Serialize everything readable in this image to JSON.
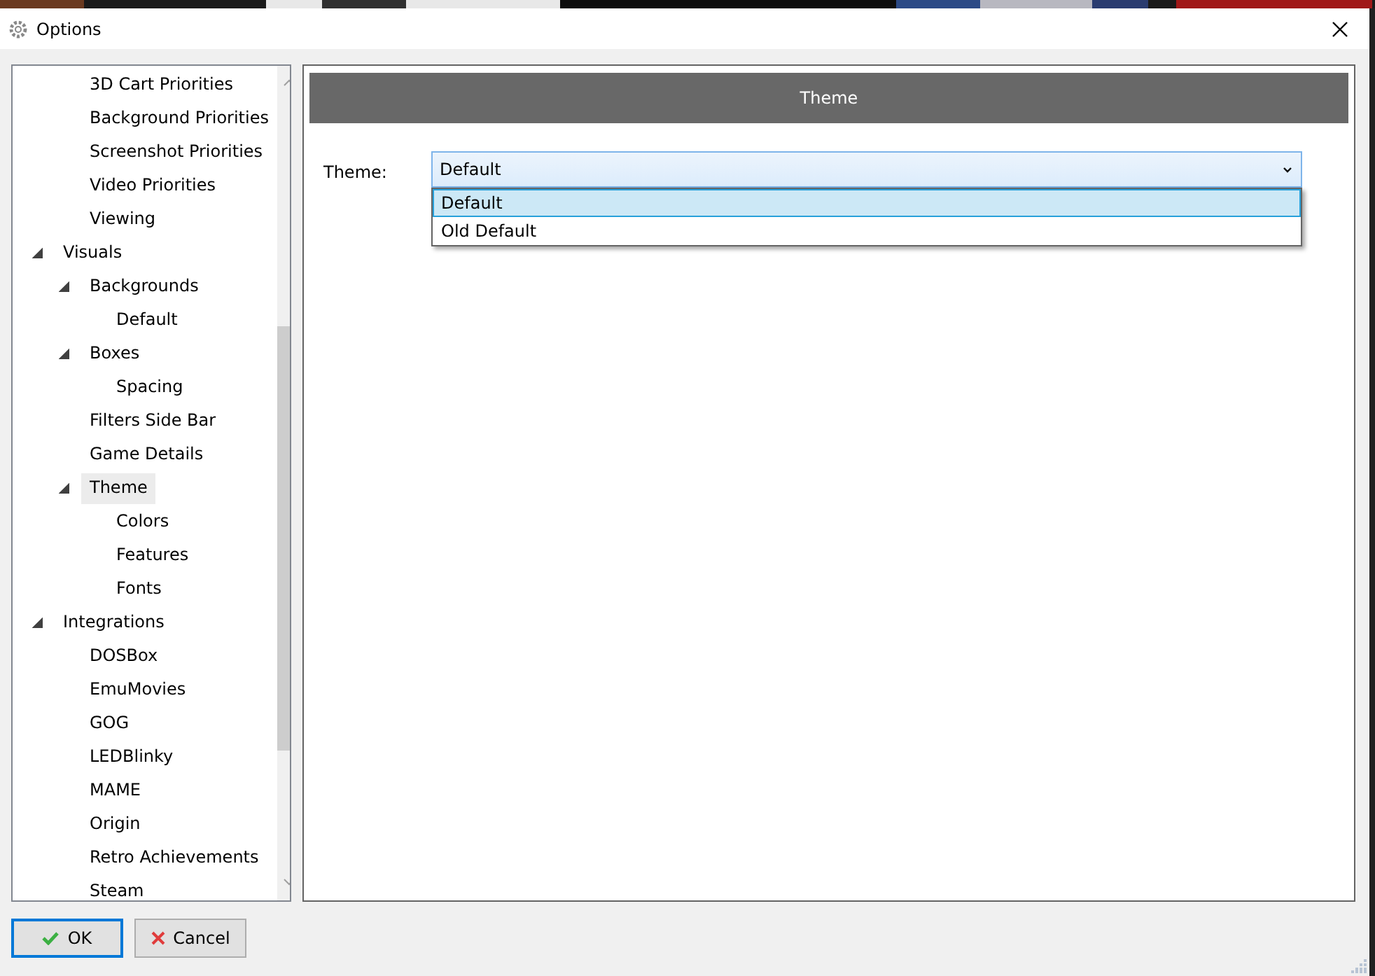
{
  "window": {
    "title": "Options"
  },
  "tree": [
    {
      "children": [
        {
          "label": "3D Cart Priorities",
          "selected": false
        },
        {
          "label": "Background Priorities",
          "selected": false
        },
        {
          "label": "Screenshot Priorities",
          "selected": false
        },
        {
          "label": "Video Priorities",
          "selected": false
        },
        {
          "label": "Viewing",
          "selected": false
        }
      ]
    },
    {
      "label": "Visuals",
      "selected": false,
      "expanded": true,
      "children": [
        {
          "label": "Backgrounds",
          "selected": false,
          "expanded": true,
          "children": [
            {
              "label": "Default",
              "selected": false
            }
          ]
        },
        {
          "label": "Boxes",
          "selected": false,
          "expanded": true,
          "children": [
            {
              "label": "Spacing",
              "selected": false
            }
          ]
        },
        {
          "label": "Filters Side Bar",
          "selected": false
        },
        {
          "label": "Game Details",
          "selected": false
        },
        {
          "label": "Theme",
          "selected": true,
          "expanded": true,
          "children": [
            {
              "label": "Colors",
              "selected": false
            },
            {
              "label": "Features",
              "selected": false
            },
            {
              "label": "Fonts",
              "selected": false
            }
          ]
        }
      ]
    },
    {
      "label": "Integrations",
      "selected": false,
      "expanded": true,
      "children": [
        {
          "label": "DOSBox",
          "selected": false
        },
        {
          "label": "EmuMovies",
          "selected": false
        },
        {
          "label": "GOG",
          "selected": false
        },
        {
          "label": "LEDBlinky",
          "selected": false
        },
        {
          "label": "MAME",
          "selected": false
        },
        {
          "label": "Origin",
          "selected": false
        },
        {
          "label": "Retro Achievements",
          "selected": false
        },
        {
          "label": "Steam",
          "selected": false
        }
      ]
    }
  ],
  "panel": {
    "header": "Theme",
    "field_label": "Theme:",
    "value": "Default",
    "options": [
      {
        "label": "Default",
        "selected": true
      },
      {
        "label": "Old Default",
        "selected": false
      }
    ]
  },
  "buttons": [
    {
      "label": "OK",
      "kind": "ok",
      "focused": true
    },
    {
      "label": "Cancel",
      "kind": "cancel",
      "focused": false
    }
  ]
}
